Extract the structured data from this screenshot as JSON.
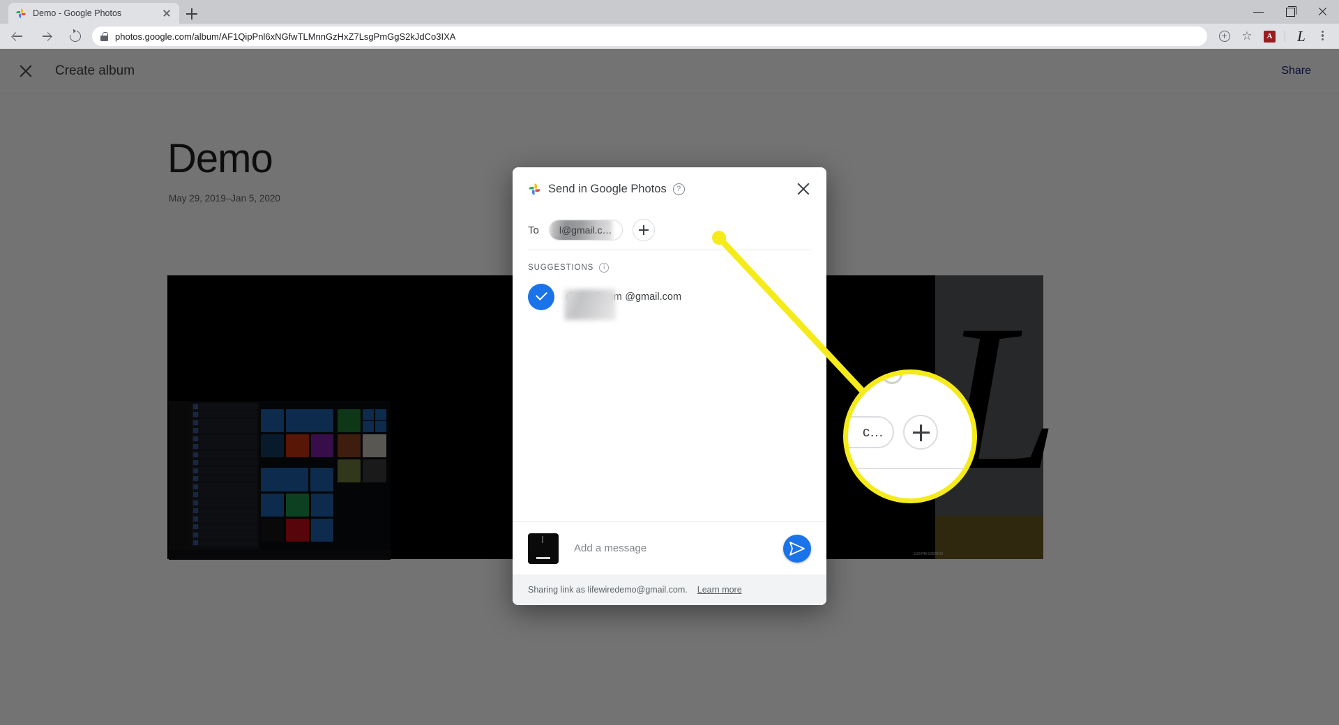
{
  "browser": {
    "tab": {
      "title": "Demo - Google Photos",
      "favicon": "google-photos-icon"
    },
    "newtab_label": "+",
    "url": "photos.google.com/album/AF1QipPnl6xNGfwTLMnnGzHxZ7LsgPmGgS2kJdCo3IXA",
    "toolbar_icons": [
      "install-icon",
      "bookmark-star-icon",
      "adobe-acrobat-extension-icon",
      "profile-avatar-icon",
      "chrome-menu-icon"
    ],
    "acrobat_glyph": "A",
    "avatar_glyph": "L",
    "window_controls": [
      "minimize",
      "maximize",
      "close"
    ]
  },
  "photos_page": {
    "header": {
      "close_label": "close-icon",
      "title": "Create album",
      "share_label": "Share"
    },
    "album": {
      "name": "Demo",
      "dates": "May 29, 2019–Jan 5, 2020"
    },
    "photo_l_glyph": "L",
    "photo_clock": "3:29 PM 5/29/2019"
  },
  "dialog": {
    "logo": "google-photos-icon",
    "title": "Send in Google Photos",
    "help_glyph": "?",
    "close_glyph": "×",
    "to": {
      "label": "To",
      "chip_value": "l@gmail.c…"
    },
    "add_recipient_label": "+",
    "suggestions": {
      "label": "SUGGESTIONS",
      "info_glyph": "i",
      "items": [
        {
          "selected": true,
          "line1": "@gmail.com",
          "line2": "@gmail.com"
        }
      ]
    },
    "composer": {
      "placeholder": "Add a message",
      "send_label": "send-icon"
    },
    "footer": {
      "text": "Sharing link as lifewiredemo@gmail.com.",
      "link": "Learn more"
    }
  },
  "callout": {
    "magnifier_chip_text": "c…",
    "magnifier_plus": "+",
    "highlight_color": "#f5eb1b"
  }
}
